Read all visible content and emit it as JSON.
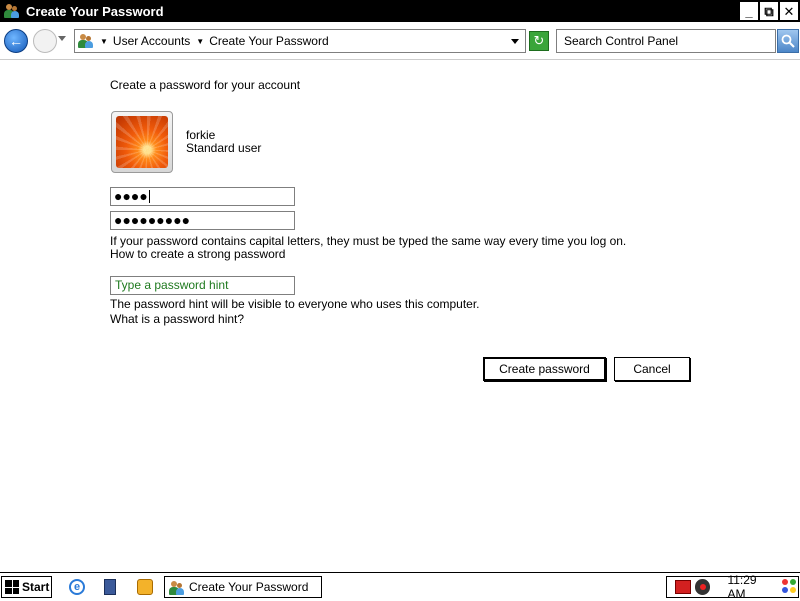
{
  "window": {
    "title": "Create Your Password",
    "icon": "user-accounts-icon",
    "controls": {
      "minimize": "_",
      "restore": "⧉",
      "close": "✕"
    }
  },
  "navigation": {
    "back_glyph": "←",
    "breadcrumb": [
      "User Accounts",
      "Create Your Password"
    ],
    "search_placeholder": "Search Control Panel",
    "refresh_glyph": "↻"
  },
  "content": {
    "heading": "Create a password for your account",
    "user": {
      "name": "forkie",
      "type": "Standard user"
    },
    "password_value": "●●●●",
    "confirm_value": "●●●●●●●●●",
    "caps_note": "If your password contains capital letters, they must be typed the same way every time you log on.",
    "strong_password_link": "How to create a strong password",
    "hint_placeholder": "Type a password hint",
    "hint_note": "The password hint will be visible to everyone who uses this computer.",
    "hint_link": "What is a password hint?",
    "create_button": "Create password",
    "cancel_button": "Cancel"
  },
  "taskbar": {
    "start_label": "Start",
    "ie_glyph": "e",
    "task_label": "Create Your Password",
    "clock": "11:29 AM"
  },
  "colors": {
    "titlebar": "#000000",
    "hint_text": "#1f7a1f",
    "back_button": "#1358b8"
  }
}
